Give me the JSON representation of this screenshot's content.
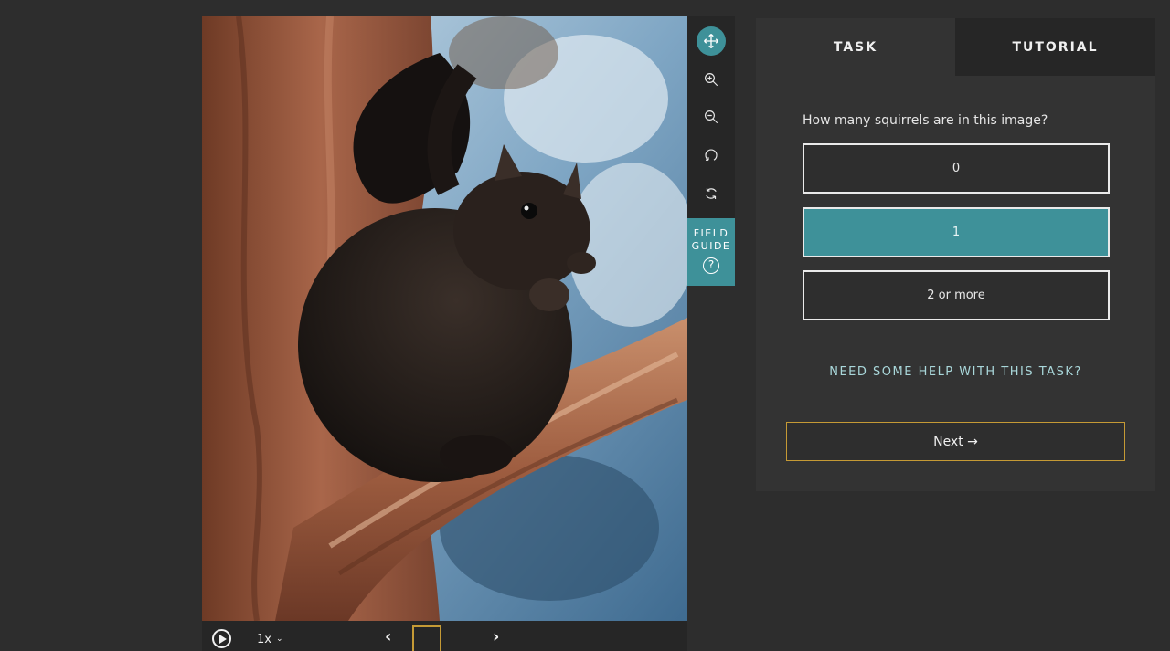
{
  "viewer": {
    "subject_image": "squirrel-in-tree-photo",
    "frame_rate_label": "1x",
    "icons": {
      "play": "play-icon",
      "rate_dropdown": "chevron-down-icon",
      "prev": "chevron-left-icon",
      "next": "chevron-right-icon"
    }
  },
  "toolbar": {
    "tools": [
      {
        "name": "move-tool",
        "icon": "move-arrows-icon",
        "active": true
      },
      {
        "name": "zoom-in-tool",
        "icon": "zoom-in-icon",
        "active": false
      },
      {
        "name": "zoom-out-tool",
        "icon": "zoom-out-icon",
        "active": false
      },
      {
        "name": "rotate-tool",
        "icon": "rotate-icon",
        "active": false
      },
      {
        "name": "reset-tool",
        "icon": "reset-icon",
        "active": false
      }
    ],
    "field_guide_line1": "FIELD",
    "field_guide_line2": "GUIDE",
    "field_guide_help": "?"
  },
  "panel": {
    "tabs": [
      "TASK",
      "TUTORIAL"
    ],
    "active_tab": "TASK",
    "question": "How many squirrels are in this image?",
    "answers": [
      "0",
      "1",
      "2 or more"
    ],
    "selected_answer": "1",
    "help_link": "NEED SOME HELP WITH THIS TASK?",
    "next_label": "Next →"
  },
  "colors": {
    "background": "#2d2d2d",
    "accent_teal": "#3e9199",
    "next_border_gold": "#c59a35",
    "help_link": "#a9d7da"
  }
}
